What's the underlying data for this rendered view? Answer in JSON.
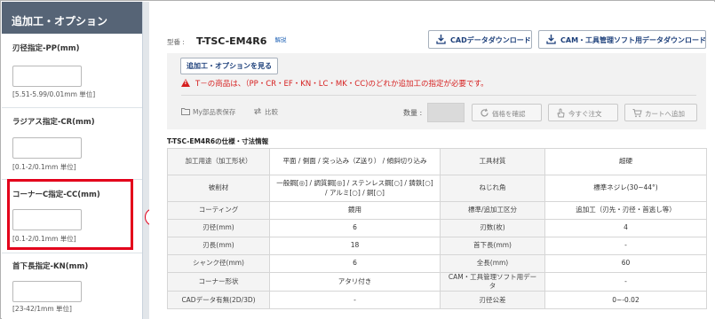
{
  "sidebar": {
    "header": "追加工・オプション",
    "sections": [
      {
        "label": "刃径指定-PP(mm)",
        "value": "",
        "hint": "[5.51-5.99/0.01mm 単位]"
      },
      {
        "label": "ラジアス指定-CR(mm)",
        "value": "",
        "hint": "[0.1-2/0.1mm 単位]"
      },
      {
        "label": "コーナーC指定-CC(mm)",
        "value": "",
        "hint": "[0.1-2/0.1mm 単位]"
      },
      {
        "label": "首下長指定-KN(mm)",
        "value": "",
        "hint": "[23-42/1mm 単位]"
      }
    ],
    "highlight_color": "#e3001b",
    "marker": "③"
  },
  "header": {
    "model_prefix": "型番 :",
    "model_code": "T-TSC-EM4R6",
    "model_link": "解説",
    "cad_button": "CADデータダウンロード",
    "cam_button": "CAM・工具管理ソフト用データダウンロード"
  },
  "options": {
    "view_button": "追加工・オプションを見る",
    "warning": "T－の商品は、（PP・CR・EF・KN・LC・MK・CC)のどれか追加工の指定が必要です。",
    "save_label": "My部品表保存",
    "compare_label": "比較",
    "qty_label": "数量 :",
    "qty_value": "",
    "price_button": "価格を確認",
    "order_button": "今すぐ注文",
    "cart_button": "カートへ追加"
  },
  "spec": {
    "title": "T-TSC-EM4R6の仕様・寸法情報",
    "rows": [
      [
        "加工用途（加工形状）",
        "平面 / 側面 / 突っ込み（Z送り） / 傾斜切り込み",
        "工具材質",
        "超硬"
      ],
      [
        "被削材",
        "一般鋼[◎] / 調質鋼[◎] / ステンレス鋼[○] / 鋳鉄[○] / アルミ[○] / 銅[○]",
        "ねじれ角",
        "標準ネジレ(30~44°)"
      ],
      [
        "コーティング",
        "鏡用",
        "標準/追加工区分",
        "追加工（刃先・刃径・首逃し等）"
      ],
      [
        "刃径(mm)",
        "6",
        "刃数(枚)",
        "4"
      ],
      [
        "刃長(mm)",
        "18",
        "首下長(mm)",
        "-"
      ],
      [
        "シャンク径(mm)",
        "6",
        "全長(mm)",
        "60"
      ],
      [
        "コーナー形状",
        "アタリ付き",
        "CAM・工具管理ソフト用データ",
        "-"
      ],
      [
        "CADデータ有無(2D/3D)",
        "-",
        "刃径公差",
        "0~-0.02"
      ]
    ]
  },
  "colors": {
    "sidebar_header_bg": "#566476",
    "link_blue": "#1c3f7a",
    "warning_red": "#d62020"
  }
}
